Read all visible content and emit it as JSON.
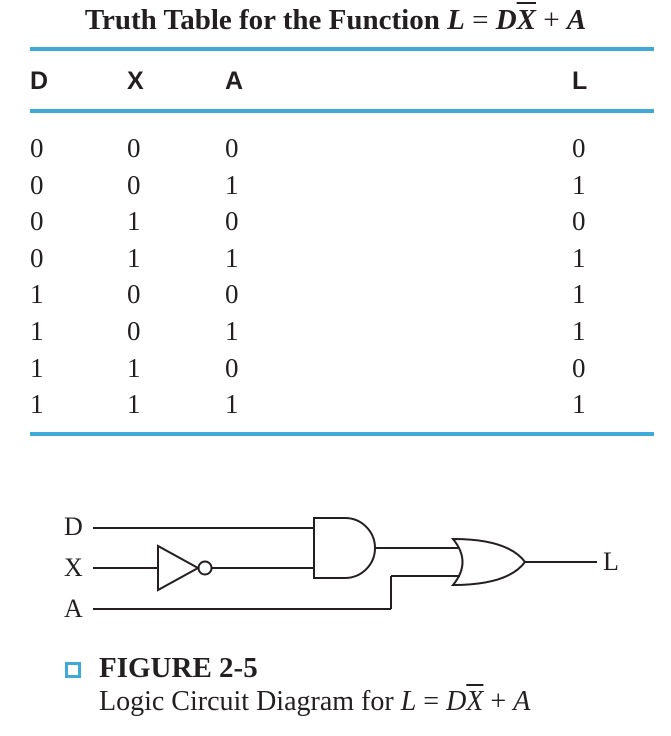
{
  "title": {
    "prefix": "Truth Table for the Function ",
    "lhs": "L",
    "eq": " = ",
    "d": "D",
    "xbar": "X",
    "plus": " + ",
    "a": "A"
  },
  "table": {
    "headers": [
      "D",
      "X",
      "A",
      "L"
    ],
    "rows": [
      [
        "0",
        "0",
        "0",
        "0"
      ],
      [
        "0",
        "0",
        "1",
        "1"
      ],
      [
        "0",
        "1",
        "0",
        "0"
      ],
      [
        "0",
        "1",
        "1",
        "1"
      ],
      [
        "1",
        "0",
        "0",
        "1"
      ],
      [
        "1",
        "0",
        "1",
        "1"
      ],
      [
        "1",
        "1",
        "0",
        "0"
      ],
      [
        "1",
        "1",
        "1",
        "1"
      ]
    ]
  },
  "circuit": {
    "inputs": [
      "D",
      "X",
      "A"
    ],
    "output": "L"
  },
  "figure": {
    "label": "FIGURE 2-5",
    "caption_prefix": "Logic Circuit Diagram for ",
    "lhs": "L",
    "eq": " = ",
    "d": "D",
    "xbar": "X",
    "plus": " + ",
    "a": "A"
  },
  "colors": {
    "accent": "#3fa9d8",
    "text": "#231f20"
  }
}
